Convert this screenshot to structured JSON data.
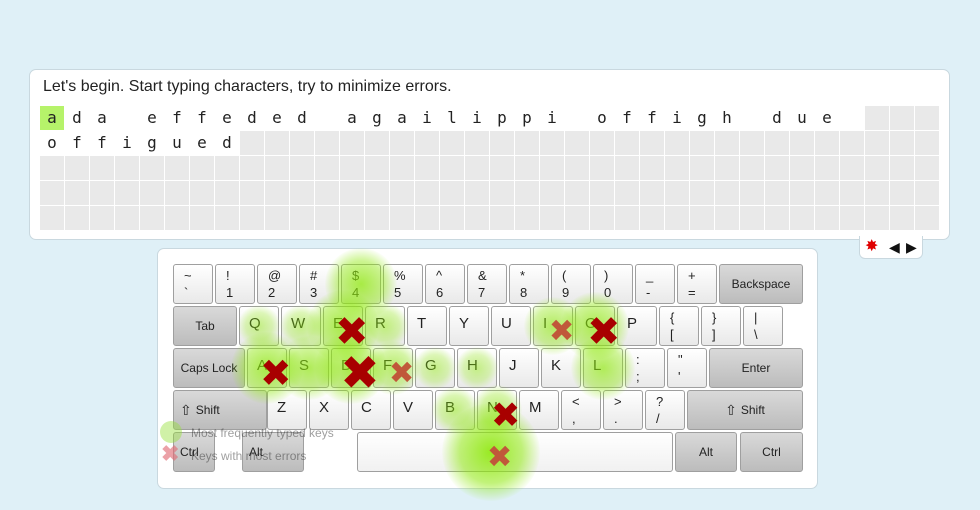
{
  "prompt": "Let's begin. Start typing characters, try to minimize errors.",
  "text_rows": [
    "ada effeded agailippi offigh due ",
    "offigued"
  ],
  "current_char_index": 0,
  "controls": {
    "settings_icon": "gear-icon",
    "prev_icon": "triangle-left-icon",
    "next_icon": "triangle-right-icon"
  },
  "keyboard": {
    "row1": [
      {
        "top": "~",
        "bottom": "`"
      },
      {
        "top": "!",
        "bottom": "1"
      },
      {
        "top": "@",
        "bottom": "2"
      },
      {
        "top": "#",
        "bottom": "3"
      },
      {
        "top": "$",
        "bottom": "4"
      },
      {
        "top": "%",
        "bottom": "5"
      },
      {
        "top": "^",
        "bottom": "6"
      },
      {
        "top": "&",
        "bottom": "7"
      },
      {
        "top": "*",
        "bottom": "8"
      },
      {
        "top": "(",
        "bottom": "9"
      },
      {
        "top": ")",
        "bottom": "0"
      },
      {
        "top": "_",
        "bottom": "-"
      },
      {
        "top": "+",
        "bottom": "="
      }
    ],
    "backspace": "Backspace",
    "tab": "Tab",
    "row2": [
      "Q",
      "W",
      "E",
      "R",
      "T",
      "Y",
      "U",
      "I",
      "O",
      "P"
    ],
    "row2_sym": [
      {
        "top": "{",
        "bottom": "["
      },
      {
        "top": "}",
        "bottom": "]"
      },
      {
        "top": "|",
        "bottom": "\\"
      }
    ],
    "caps": "Caps Lock",
    "row3": [
      "A",
      "S",
      "D",
      "F",
      "G",
      "H",
      "J",
      "K",
      "L"
    ],
    "row3_sym": [
      {
        "top": ":",
        "bottom": ";"
      },
      {
        "top": "\"",
        "bottom": "'"
      }
    ],
    "enter": "Enter",
    "shift_left": "Shift",
    "row4": [
      "Z",
      "X",
      "C",
      "V",
      "B",
      "N",
      "M"
    ],
    "row4_sym": [
      {
        "top": "<",
        "bottom": ","
      },
      {
        "top": ">",
        "bottom": "."
      },
      {
        "top": "?",
        "bottom": "/"
      }
    ],
    "shift_right": "Shift",
    "ctrl_left": "Ctrl",
    "alt_left": "Alt",
    "alt_right": "Alt",
    "ctrl_right": "Ctrl"
  },
  "frequency": {
    "4": 1,
    "E": 1,
    "Q": 0.3,
    "W": 0.3,
    "R": 0.4,
    "I": 0.7,
    "O": 0.9,
    "A": 1,
    "S": 0.8,
    "D": 1,
    "F": 0.6,
    "L": 0.8,
    "G": 0.3,
    "H": 0.3,
    "B": 0.4,
    "N": 0.5,
    "space": 1.6
  },
  "errors": {
    "E": 1.0,
    "D": 1.3,
    "O": 1.0,
    "A": 0.9,
    "N": 0.8,
    "I": 0.6,
    "F": 0.6,
    "space": 0.6
  },
  "legend": {
    "frequent_label": "Most frequently typed keys",
    "errors_label": "Keys with most errors"
  },
  "colors": {
    "current_char": "#b6f36a",
    "heat": "#8ee80a",
    "error_mark": "#b30000"
  }
}
